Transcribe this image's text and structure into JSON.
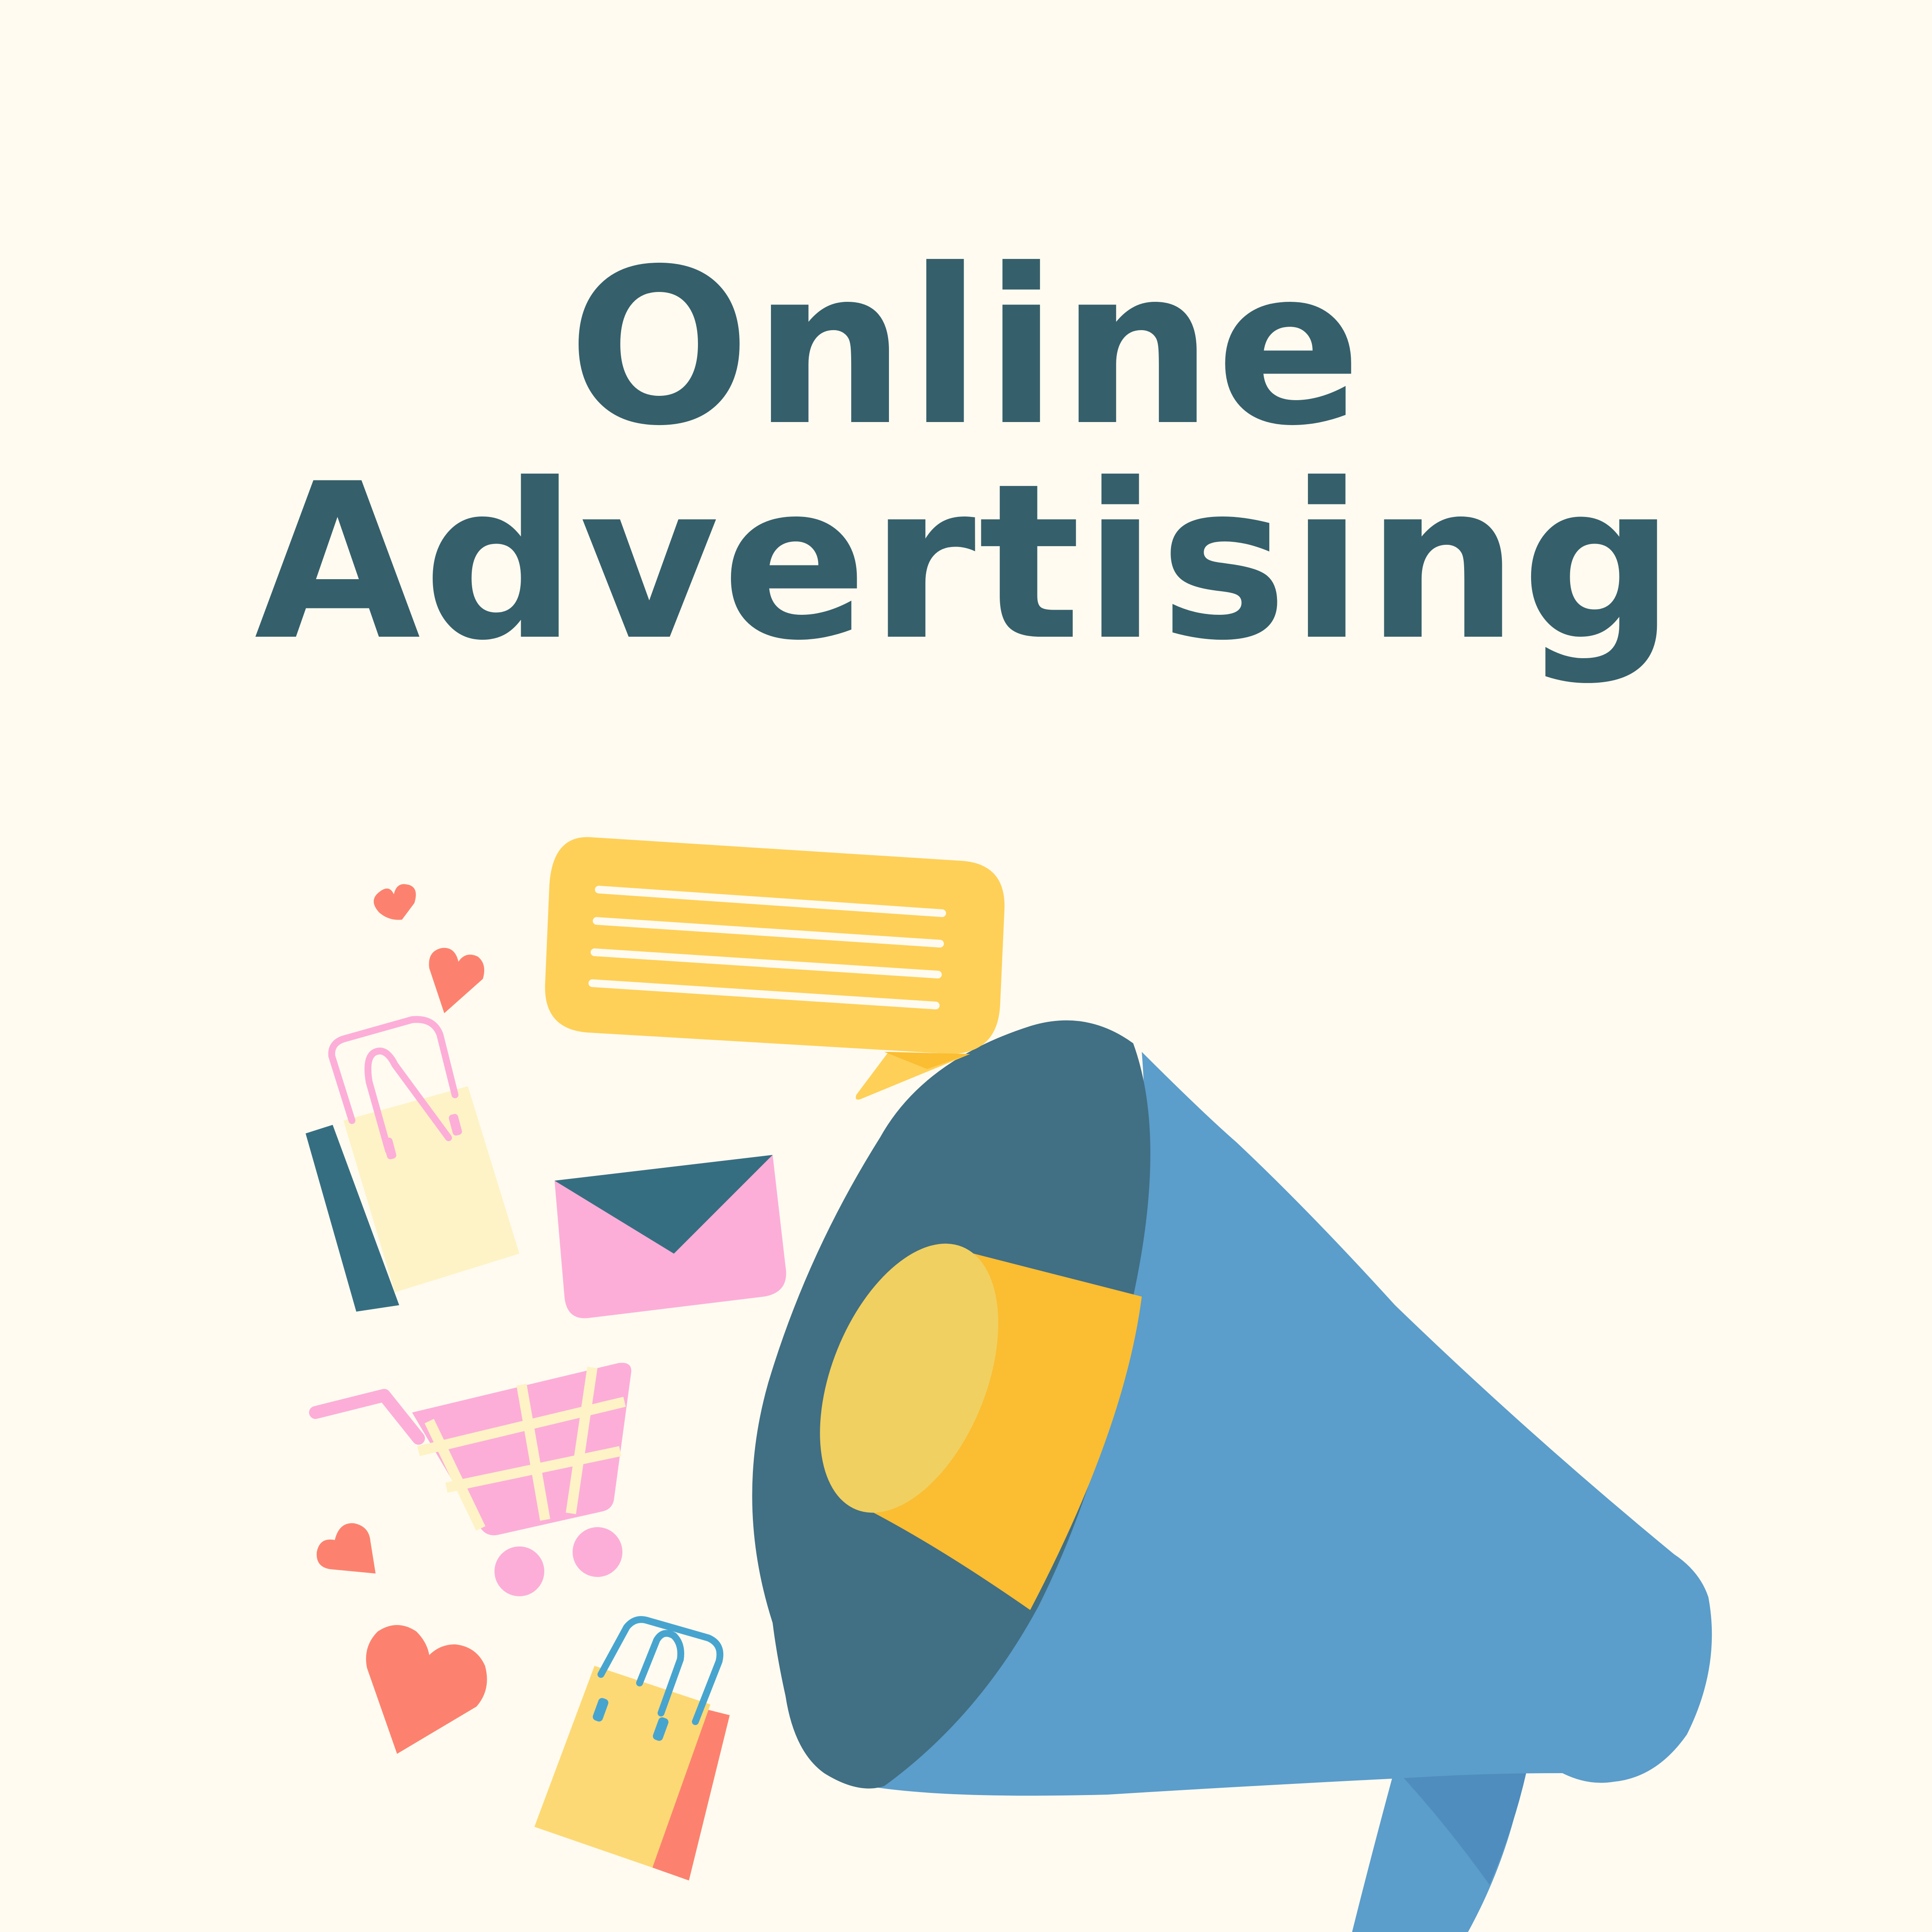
{
  "title": {
    "line1": "Online",
    "line2": "Advertising"
  },
  "colors": {
    "background": "#FFFBF0",
    "title": "#355F6B",
    "megaphone_dark": "#416F84",
    "megaphone_light": "#5B9DCB",
    "megaphone_inner": "#FBBD32",
    "megaphone_rim": "#F0D060",
    "speech_bubble": "#FED058",
    "envelope": "#FCAED8",
    "envelope_flap": "#366E81",
    "heart": "#FC826F",
    "cart": "#FCAED8",
    "bag_cream": "#FEF3C6",
    "bag_yellow": "#FDD975",
    "bag_coral": "#FC826F"
  },
  "icons": [
    "megaphone-icon",
    "speech-bubble-icon",
    "envelope-icon",
    "shopping-cart-icon",
    "shopping-bag-icon",
    "heart-icon"
  ]
}
